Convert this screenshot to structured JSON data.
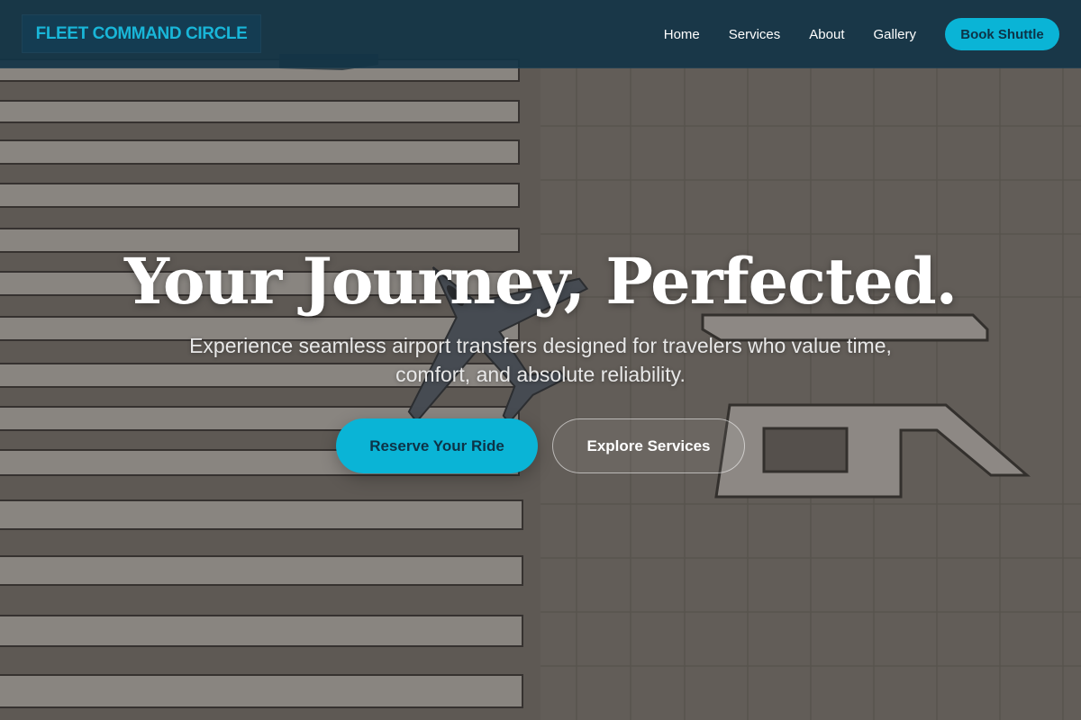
{
  "header": {
    "logo_text": "FLEET COMMAND CIRCLE",
    "nav_items": [
      {
        "label": "Home"
      },
      {
        "label": "Services"
      },
      {
        "label": "About"
      },
      {
        "label": "Gallery"
      }
    ],
    "book_label": "Book Shuttle"
  },
  "hero": {
    "title": "Your Journey, Perfected.",
    "subtitle": "Experience seamless airport transfers designed for travelers who value time, comfort, and absolute reliability.",
    "primary_cta": "Reserve Your Ride",
    "secondary_cta": "Explore Services",
    "background_description_icon": "airport-runway-aerial-photo"
  },
  "colors": {
    "accent": "#0ab4d6",
    "header_bg": "#123446",
    "logo_bg": "#143c52",
    "button_text_dark": "#0d3347"
  }
}
